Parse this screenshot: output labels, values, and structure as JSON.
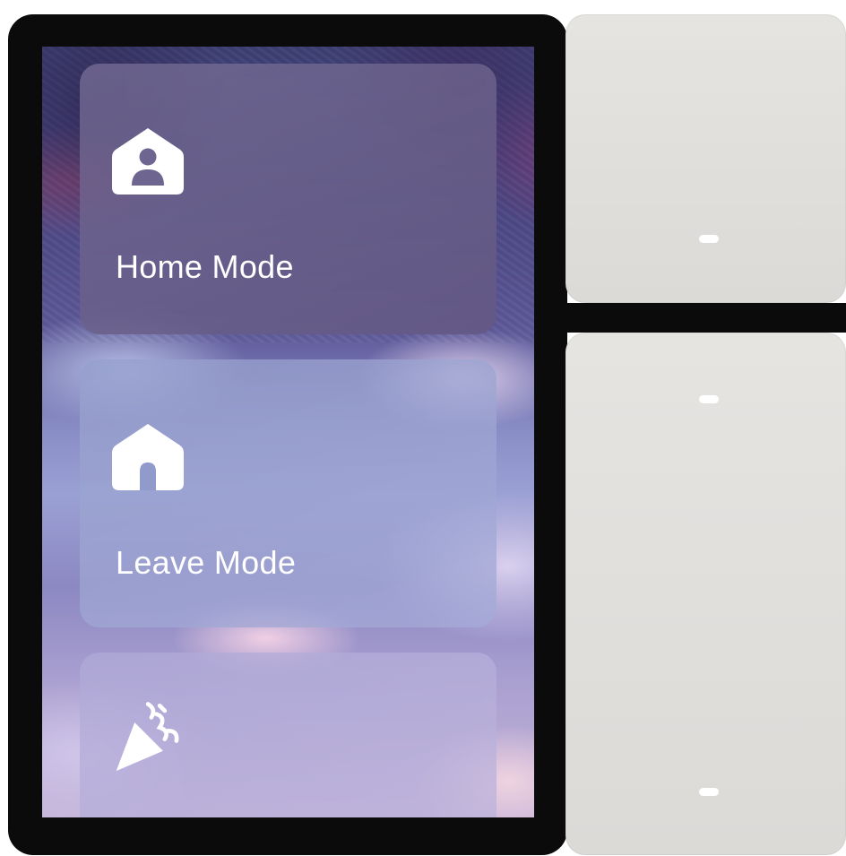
{
  "panel": {
    "tiles": [
      {
        "label": "Home Mode",
        "icon": "home-person-icon"
      },
      {
        "label": "Leave Mode",
        "icon": "home-door-icon"
      },
      {
        "label": "",
        "icon": "party-popper-icon"
      }
    ]
  },
  "switches": {
    "indicator_color": "#ffffff",
    "panel_color": "#e0dedb"
  },
  "colors": {
    "frame": "#0b0b0c",
    "text": "#ffffff"
  }
}
